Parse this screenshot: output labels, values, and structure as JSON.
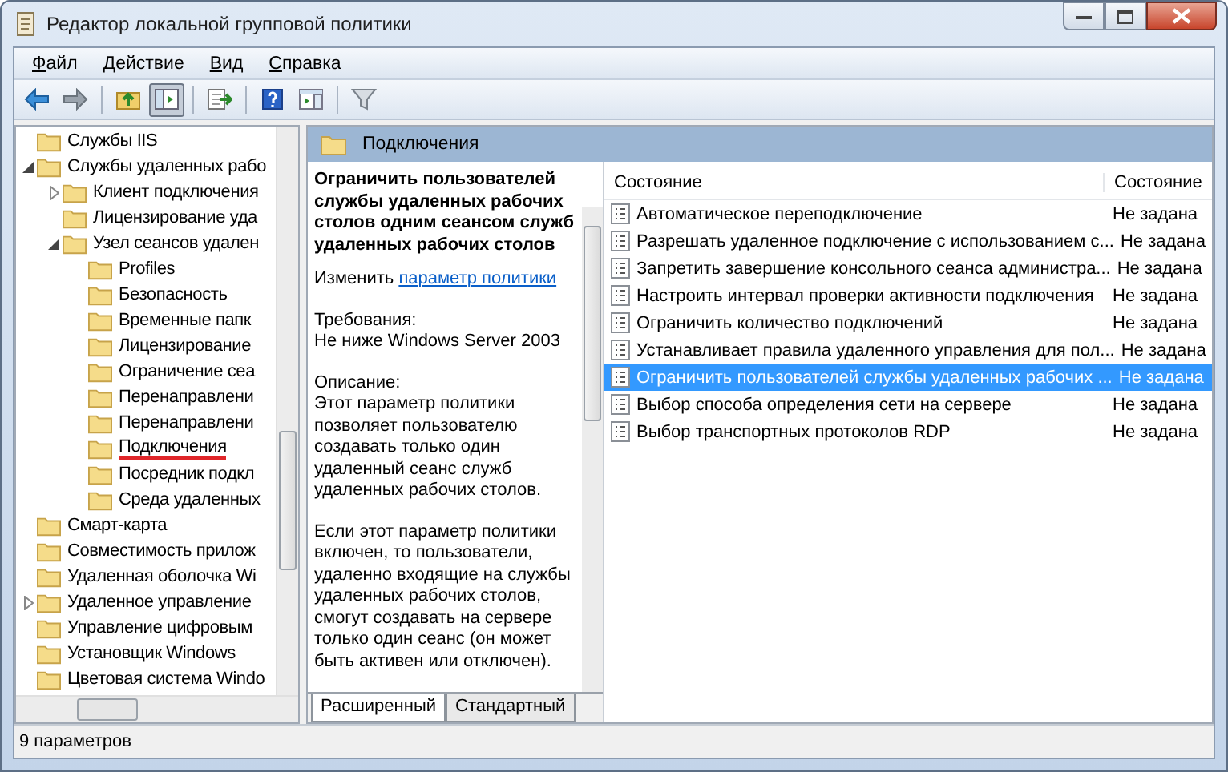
{
  "window": {
    "title": "Редактор локальной групповой политики"
  },
  "menu": [
    "Файл",
    "Действие",
    "Вид",
    "Справка"
  ],
  "toolbar": [
    {
      "kind": "back",
      "pressed": false
    },
    {
      "kind": "forward",
      "pressed": false
    },
    {
      "kind": "separator"
    },
    {
      "kind": "up",
      "pressed": false
    },
    {
      "kind": "tree",
      "pressed": true
    },
    {
      "kind": "separator"
    },
    {
      "kind": "export",
      "pressed": false
    },
    {
      "kind": "separator"
    },
    {
      "kind": "help",
      "pressed": false
    },
    {
      "kind": "view",
      "pressed": false
    },
    {
      "kind": "separator"
    },
    {
      "kind": "filter",
      "pressed": false
    }
  ],
  "tree": [
    {
      "label": "Службы IIS",
      "marked": false
    },
    {
      "label": "Службы удаленных рабо",
      "expanded": true,
      "marked": false,
      "children": [
        {
          "label": "Клиент подключения",
          "expanded": false,
          "marked": false
        },
        {
          "label": "Лицензирование уда",
          "marked": false
        },
        {
          "label": "Узел сеансов удален",
          "expanded": true,
          "marked": false,
          "children": [
            {
              "label": "Profiles",
              "marked": false
            },
            {
              "label": "Безопасность",
              "marked": false
            },
            {
              "label": "Временные папк",
              "marked": false
            },
            {
              "label": "Лицензирование",
              "marked": false
            },
            {
              "label": "Ограничение сеа",
              "marked": false
            },
            {
              "label": "Перенаправлени",
              "marked": false
            },
            {
              "label": "Перенаправлени",
              "marked": false
            },
            {
              "label": "Подключения",
              "marked": true
            },
            {
              "label": "Посредник подкл",
              "marked": false
            },
            {
              "label": "Среда удаленных",
              "marked": false
            }
          ]
        }
      ]
    },
    {
      "label": "Смарт-карта",
      "marked": false
    },
    {
      "label": "Совместимость прилож",
      "marked": false
    },
    {
      "label": "Удаленная оболочка Wi",
      "marked": false
    },
    {
      "label": "Удаленное управление",
      "expanded": false,
      "marked": false
    },
    {
      "label": "Управление цифровым",
      "marked": false
    },
    {
      "label": "Установщик Windows",
      "marked": false
    },
    {
      "label": "Цветовая система Windo",
      "marked": false
    }
  ],
  "header": {
    "title": "Подключения"
  },
  "description": {
    "title": "Ограничить пользователей службы удаленных рабочих столов одним сеансом служб удаленных рабочих столов",
    "edit_prefix": "Изменить",
    "edit_link": "параметр политики",
    "requirements_label": "Требования:",
    "requirements": "Не ниже Windows Server 2003",
    "description_label": "Описание:",
    "paragraphs": [
      "Этот параметр политики позволяет пользователю создавать только один удаленный сеанс служб удаленных рабочих столов.",
      "Если этот параметр политики включен, то пользователи, удаленно входящие на службы удаленных рабочих столов, смогут создавать на сервере только один сеанс (он может быть активен или отключен)."
    ]
  },
  "view_tabs": [
    {
      "label": "Расширенный",
      "selected": true
    },
    {
      "label": "Стандартный",
      "selected": false
    }
  ],
  "list": {
    "columns": [
      "Состояние",
      "Состояние"
    ],
    "rows": [
      {
        "name": "Автоматическое переподключение",
        "state": "Не задана",
        "selected": false
      },
      {
        "name": "Разрешать удаленное подключение с использованием с...",
        "state": "Не задана",
        "selected": false
      },
      {
        "name": "Запретить завершение консольного сеанса администра...",
        "state": "Не задана",
        "selected": false
      },
      {
        "name": "Настроить интервал проверки активности подключения",
        "state": "Не задана",
        "selected": false
      },
      {
        "name": "Ограничить количество подключений",
        "state": "Не задана",
        "selected": false
      },
      {
        "name": "Устанавливает правила удаленного управления для пол...",
        "state": "Не задана",
        "selected": false
      },
      {
        "name": "Ограничить пользователей службы удаленных рабочих ...",
        "state": "Не задана",
        "selected": true
      },
      {
        "name": "Выбор способа определения сети на сервере",
        "state": "Не задана",
        "selected": false
      },
      {
        "name": "Выбор транспортных протоколов RDP",
        "state": "Не задана",
        "selected": false
      }
    ]
  },
  "status_bar": "9 параметров"
}
